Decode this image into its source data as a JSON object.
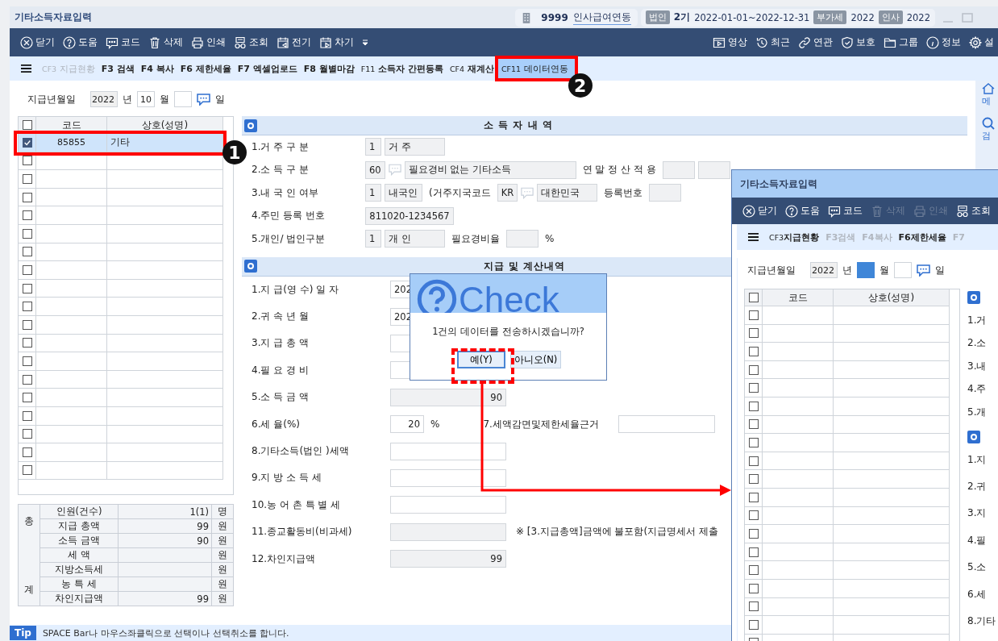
{
  "window": {
    "title": "기타소득자료입력"
  },
  "company": {
    "code": "9999",
    "name": "인사급여연동"
  },
  "period": {
    "tag": "법인",
    "term": "2기",
    "range": "2022-01-01~2022-12-31"
  },
  "years": [
    {
      "tag": "부가세",
      "value": "2022"
    },
    {
      "tag": "인사",
      "value": "2022"
    }
  ],
  "toolbar": {
    "left": [
      {
        "label": "닫기",
        "disabled": false
      },
      {
        "label": "도움",
        "disabled": false
      },
      {
        "label": "코드",
        "disabled": false
      },
      {
        "label": "삭제",
        "disabled": false
      },
      {
        "label": "인쇄",
        "disabled": false
      },
      {
        "label": "조회",
        "disabled": false
      },
      {
        "label": "전기",
        "disabled": false
      },
      {
        "label": "차기",
        "disabled": false
      }
    ],
    "right": [
      {
        "label": "영상"
      },
      {
        "label": "최근"
      },
      {
        "label": "연관"
      },
      {
        "label": "보호"
      },
      {
        "label": "그룹"
      },
      {
        "label": "정보"
      },
      {
        "label": "설"
      }
    ]
  },
  "funcbar": [
    {
      "key": "CF3",
      "label": "지급현황",
      "disabled": true,
      "selected": false
    },
    {
      "key": "F3",
      "label": "검색",
      "disabled": false,
      "selected": false
    },
    {
      "key": "F4",
      "label": "복사",
      "disabled": false,
      "selected": false
    },
    {
      "key": "F6",
      "label": "제한세율",
      "disabled": false,
      "selected": false
    },
    {
      "key": "F7",
      "label": "엑셀업로드",
      "disabled": false,
      "selected": false
    },
    {
      "key": "F8",
      "label": "월별마감",
      "disabled": false,
      "selected": false
    },
    {
      "key": "F11",
      "label": "소득자 간편등록",
      "disabled": false,
      "selected": false
    },
    {
      "key": "CF4",
      "label": "재계산",
      "disabled": false,
      "selected": false
    },
    {
      "key": "CF11",
      "label": "데이터연동",
      "disabled": false,
      "selected": true
    }
  ],
  "sidebar": [
    "메",
    "검"
  ],
  "date": {
    "label": "지급년월일",
    "year": "2022",
    "year_unit": "년",
    "month": "10",
    "month_unit": "월",
    "day_unit": "일"
  },
  "grid": {
    "all_checked": false,
    "columns": [
      "코드",
      "상호(성명)"
    ],
    "rows": [
      {
        "checked": true,
        "selected": true,
        "code": "85855",
        "name": "기타"
      },
      {
        "checked": false,
        "selected": false
      },
      {
        "checked": false,
        "selected": false
      },
      {
        "checked": false,
        "selected": false
      },
      {
        "checked": false,
        "selected": false
      },
      {
        "checked": false,
        "selected": false
      },
      {
        "checked": false,
        "selected": false
      },
      {
        "checked": false,
        "selected": false
      },
      {
        "checked": false,
        "selected": false
      },
      {
        "checked": false,
        "selected": false
      },
      {
        "checked": false,
        "selected": false
      },
      {
        "checked": false,
        "selected": false
      },
      {
        "checked": false,
        "selected": false
      },
      {
        "checked": false,
        "selected": false
      },
      {
        "checked": false,
        "selected": false
      },
      {
        "checked": false,
        "selected": false
      },
      {
        "checked": false,
        "selected": false
      },
      {
        "checked": false,
        "selected": false
      },
      {
        "checked": false,
        "selected": false
      }
    ]
  },
  "summary": {
    "side": [
      "총",
      "계"
    ],
    "rows": [
      {
        "label": "인원(건수)",
        "value": "1(1)",
        "unit": "명"
      },
      {
        "label": "지급 총액",
        "value": "99",
        "unit": "원"
      },
      {
        "label": "소득 금액",
        "value": "90",
        "unit": "원"
      },
      {
        "label": "세 액",
        "unit": "원"
      },
      {
        "label": "지방소득세",
        "unit": "원"
      },
      {
        "label": "농 특 세",
        "unit": "원"
      },
      {
        "label": "차인지급액",
        "value": "99",
        "unit": "원"
      }
    ]
  },
  "sections": [
    {
      "title": "소 득 자 내 역",
      "rows": [
        {
          "label": "1.거 주 구 분",
          "parts": [
            {
              "kind": "code",
              "text": "1"
            },
            {
              "kind": "name",
              "text": "거 주"
            }
          ]
        },
        {
          "label": "2.소 득 구 분",
          "parts": [
            {
              "kind": "code",
              "text": "60"
            },
            {
              "kind": "lookup"
            },
            {
              "kind": "longname",
              "text": "필요경비 없는 기타소득"
            },
            {
              "kind": "text",
              "text": "연 말 정 산 적 용"
            },
            {
              "kind": "box"
            },
            {
              "kind": "widebox"
            }
          ]
        },
        {
          "label": "3.내 국 인 여부",
          "parts": [
            {
              "kind": "code",
              "text": "1"
            },
            {
              "kind": "short",
              "text": "내국인"
            },
            {
              "kind": "text",
              "text": "(거주지국코드"
            },
            {
              "kind": "code",
              "text": "KR"
            },
            {
              "kind": "lookup"
            },
            {
              "kind": "name",
              "text": "대한민국"
            },
            {
              "kind": "text",
              "text": "등록번호"
            },
            {
              "kind": "widebox"
            }
          ]
        },
        {
          "label": "4.주민 등록 번호",
          "parts": [
            {
              "kind": "idnum",
              "text": "811020-1234567"
            }
          ]
        },
        {
          "label": "5.개인/ 법인구분",
          "parts": [
            {
              "kind": "code",
              "text": "1"
            },
            {
              "kind": "name",
              "text": "개 인"
            },
            {
              "kind": "text",
              "text": "필요경비율"
            },
            {
              "kind": "box"
            },
            {
              "kind": "text",
              "text": "%"
            }
          ]
        }
      ]
    },
    {
      "title": "지급 및 계산내역",
      "rows": [
        {
          "label": "1.지 급(영 수) 일 자",
          "parts": [
            {
              "kind": "date",
              "text": "202"
            }
          ]
        },
        {
          "label": "2.귀 속 년 월",
          "parts": [
            {
              "kind": "date",
              "text": "202"
            }
          ]
        },
        {
          "label": "3.지 급 총 액",
          "parts": [
            {
              "kind": "amount"
            }
          ]
        },
        {
          "label": "4.필 요 경 비",
          "parts": [
            {
              "kind": "amount"
            }
          ]
        },
        {
          "label": "5.소 득 금 액",
          "parts": [
            {
              "kind": "readonly",
              "text": "90"
            }
          ]
        },
        {
          "label": "6.세 율(%)",
          "parts": [
            {
              "kind": "rate",
              "text": "20"
            },
            {
              "kind": "text",
              "text": "%"
            },
            {
              "kind": "caption",
              "text": "7.세액감면및제한세율근거"
            },
            {
              "kind": "reason"
            }
          ]
        },
        {
          "label": "8.기타소득(법인 )세액",
          "parts": [
            {
              "kind": "amount"
            }
          ]
        },
        {
          "label": "9.지 방 소 득 세",
          "parts": [
            {
              "kind": "amount"
            }
          ]
        },
        {
          "label": "10.농 어 촌 특 별 세",
          "parts": [
            {
              "kind": "amount"
            }
          ]
        },
        {
          "label": "11.종교활동비(비과세)",
          "parts": [
            {
              "kind": "readonly"
            },
            {
              "kind": "note",
              "text": "※ [3.지급총액]금액에 불포함(지급명세서 제출"
            }
          ]
        },
        {
          "label": "12.차인지급액",
          "parts": [
            {
              "kind": "readonly",
              "text": "99"
            }
          ]
        }
      ]
    }
  ],
  "tip": {
    "badge": "Tip",
    "text": "SPACE Bar나 마우스좌클릭으로 선택이나 선택취소를 합니다."
  },
  "dialog": {
    "logo": "Check",
    "message": "1건의 데이터를 전송하시겠습니까?",
    "buttons": [
      {
        "label": "예(Y)",
        "selected": true
      },
      {
        "label": "아니오(N)",
        "selected": false
      }
    ]
  },
  "second_window": {
    "title": "기타소득자료입력",
    "toolbar": [
      {
        "label": "닫기",
        "disabled": false
      },
      {
        "label": "도움",
        "disabled": false
      },
      {
        "label": "코드",
        "disabled": false
      },
      {
        "label": "삭제",
        "disabled": true
      },
      {
        "label": "인쇄",
        "disabled": true
      },
      {
        "label": "조회",
        "disabled": false
      }
    ],
    "funcbar": [
      {
        "key": "CF3",
        "label": "지급현황",
        "disabled": false
      },
      {
        "key": "F3",
        "label": "검색",
        "disabled": true
      },
      {
        "key": "F4",
        "label": "복사",
        "disabled": true
      },
      {
        "key": "F6",
        "label": "제한세율",
        "disabled": false
      },
      {
        "key": "F7",
        "disabled": true
      }
    ],
    "date": {
      "label": "지급년월일",
      "year": "2022",
      "year_unit": "년",
      "month_focused": true,
      "month_unit": "월",
      "day_unit": "일"
    },
    "all_checked": false,
    "columns": [
      "코드",
      "상호(성명)"
    ],
    "rows": [
      {
        "checked": false
      },
      {
        "checked": false
      },
      {
        "checked": false
      },
      {
        "checked": false
      },
      {
        "checked": false
      },
      {
        "checked": false
      },
      {
        "checked": false
      },
      {
        "checked": false
      },
      {
        "checked": false
      },
      {
        "checked": false
      },
      {
        "checked": false
      },
      {
        "checked": false
      },
      {
        "checked": false
      },
      {
        "checked": false
      },
      {
        "checked": false
      },
      {
        "checked": false
      },
      {
        "checked": false
      },
      {
        "checked": false
      },
      {
        "checked": false
      }
    ],
    "labels_top": [
      "1.거",
      "2.소",
      "3.내",
      "4.주",
      "5.개"
    ],
    "labels_bottom": [
      "1.지",
      "2.귀",
      "3.지",
      "4.필",
      "5.소",
      "6.세",
      "8.기타"
    ]
  },
  "annotations": [
    {
      "number": "1"
    },
    {
      "number": "2"
    }
  ]
}
